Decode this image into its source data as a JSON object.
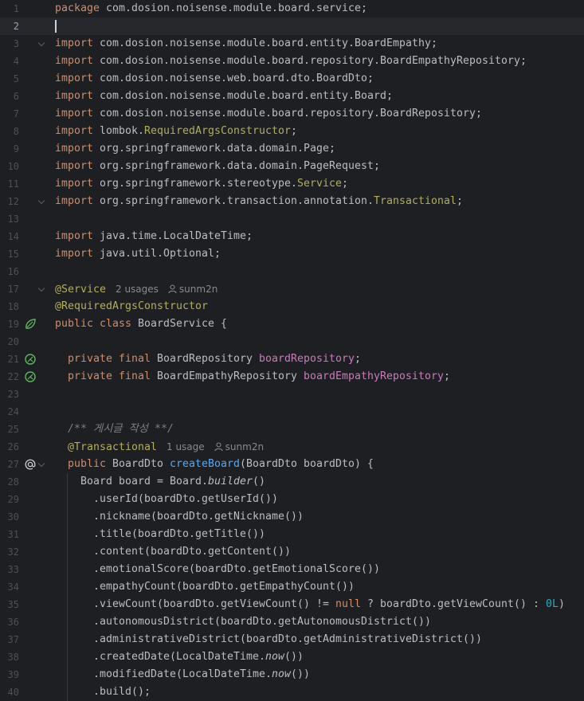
{
  "editor": {
    "language": "Java",
    "current_line": 2,
    "lines": [
      {
        "n": "1",
        "tokens": [
          {
            "t": "package",
            "c": "kw"
          },
          {
            "t": " com.dosion.noisense.module.board.service;"
          }
        ]
      },
      {
        "n": "2",
        "tokens": []
      },
      {
        "n": "3",
        "fold": true,
        "tokens": [
          {
            "t": "import",
            "c": "kw"
          },
          {
            "t": " com.dosion.noisense.module.board.entity.BoardEmpathy;"
          }
        ]
      },
      {
        "n": "4",
        "tokens": [
          {
            "t": "import",
            "c": "kw"
          },
          {
            "t": " com.dosion.noisense.module.board.repository.BoardEmpathyRepository;"
          }
        ]
      },
      {
        "n": "5",
        "tokens": [
          {
            "t": "import",
            "c": "kw"
          },
          {
            "t": " com.dosion.noisense.web.board.dto.BoardDto;"
          }
        ]
      },
      {
        "n": "6",
        "tokens": [
          {
            "t": "import",
            "c": "kw"
          },
          {
            "t": " com.dosion.noisense.module.board.entity.Board;"
          }
        ]
      },
      {
        "n": "7",
        "tokens": [
          {
            "t": "import",
            "c": "kw"
          },
          {
            "t": " com.dosion.noisense.module.board.repository.BoardRepository;"
          }
        ]
      },
      {
        "n": "8",
        "tokens": [
          {
            "t": "import",
            "c": "kw"
          },
          {
            "t": " lombok."
          },
          {
            "t": "RequiredArgsConstructor",
            "c": "ann"
          },
          {
            "t": ";"
          }
        ]
      },
      {
        "n": "9",
        "tokens": [
          {
            "t": "import",
            "c": "kw"
          },
          {
            "t": " org.springframework.data.domain.Page;"
          }
        ]
      },
      {
        "n": "10",
        "tokens": [
          {
            "t": "import",
            "c": "kw"
          },
          {
            "t": " org.springframework.data.domain.PageRequest;"
          }
        ]
      },
      {
        "n": "11",
        "tokens": [
          {
            "t": "import",
            "c": "kw"
          },
          {
            "t": " org.springframework.stereotype."
          },
          {
            "t": "Service",
            "c": "ann"
          },
          {
            "t": ";"
          }
        ]
      },
      {
        "n": "12",
        "fold": true,
        "tokens": [
          {
            "t": "import",
            "c": "kw"
          },
          {
            "t": " org.springframework.transaction.annotation."
          },
          {
            "t": "Transactional",
            "c": "ann"
          },
          {
            "t": ";"
          }
        ]
      },
      {
        "n": "13",
        "tokens": []
      },
      {
        "n": "14",
        "tokens": [
          {
            "t": "import",
            "c": "kw"
          },
          {
            "t": " java.time.LocalDateTime;"
          }
        ]
      },
      {
        "n": "15",
        "tokens": [
          {
            "t": "import",
            "c": "kw"
          },
          {
            "t": " java.util.Optional;"
          }
        ]
      },
      {
        "n": "16",
        "tokens": []
      },
      {
        "n": "17",
        "fold": true,
        "tokens": [
          {
            "t": "@Service",
            "c": "ann"
          }
        ],
        "hint": {
          "usages": "2 usages",
          "author": "sunm2n"
        }
      },
      {
        "n": "18",
        "tokens": [
          {
            "t": "@RequiredArgsConstructor",
            "c": "ann"
          }
        ]
      },
      {
        "n": "19",
        "gutter": "bean-class",
        "tokens": [
          {
            "t": "public class",
            "c": "kw"
          },
          {
            "t": " BoardService {"
          }
        ]
      },
      {
        "n": "20",
        "tokens": []
      },
      {
        "n": "21",
        "gutter": "bean-field",
        "tokens": [
          {
            "t": "  "
          },
          {
            "t": "private final",
            "c": "kw"
          },
          {
            "t": " BoardRepository "
          },
          {
            "t": "boardRepository",
            "c": "fld"
          },
          {
            "t": ";"
          }
        ]
      },
      {
        "n": "22",
        "gutter": "bean-field",
        "tokens": [
          {
            "t": "  "
          },
          {
            "t": "private final",
            "c": "kw"
          },
          {
            "t": " BoardEmpathyRepository "
          },
          {
            "t": "boardEmpathyRepository",
            "c": "fld"
          },
          {
            "t": ";"
          }
        ]
      },
      {
        "n": "23",
        "tokens": []
      },
      {
        "n": "24",
        "tokens": []
      },
      {
        "n": "25",
        "tokens": [
          {
            "t": "  "
          },
          {
            "t": "/** 게시글 작성 **/",
            "c": "cmt"
          }
        ]
      },
      {
        "n": "26",
        "tokens": [
          {
            "t": "  "
          },
          {
            "t": "@Transactional",
            "c": "ann"
          }
        ],
        "hint": {
          "usages": "1 usage",
          "author": "sunm2n"
        }
      },
      {
        "n": "27",
        "fold": true,
        "gutter": "at",
        "tokens": [
          {
            "t": "  "
          },
          {
            "t": "public",
            "c": "kw"
          },
          {
            "t": " BoardDto "
          },
          {
            "t": "createBoard",
            "c": "fn"
          },
          {
            "t": "(BoardDto boardDto) {"
          }
        ]
      },
      {
        "n": "28",
        "tokens": [
          {
            "t": "    Board board = Board."
          },
          {
            "t": "builder",
            "c": "it"
          },
          {
            "t": "()"
          }
        ]
      },
      {
        "n": "29",
        "tokens": [
          {
            "t": "      .userId(boardDto.getUserId())"
          }
        ]
      },
      {
        "n": "30",
        "tokens": [
          {
            "t": "      .nickname(boardDto.getNickname())"
          }
        ]
      },
      {
        "n": "31",
        "tokens": [
          {
            "t": "      .title(boardDto.getTitle())"
          }
        ]
      },
      {
        "n": "32",
        "tokens": [
          {
            "t": "      .content(boardDto.getContent())"
          }
        ]
      },
      {
        "n": "33",
        "tokens": [
          {
            "t": "      .emotionalScore(boardDto.getEmotionalScore())"
          }
        ]
      },
      {
        "n": "34",
        "tokens": [
          {
            "t": "      .empathyCount(boardDto.getEmpathyCount())"
          }
        ]
      },
      {
        "n": "35",
        "tokens": [
          {
            "t": "      .viewCount(boardDto.getViewCount() != "
          },
          {
            "t": "null",
            "c": "kw"
          },
          {
            "t": " ? boardDto.getViewCount() : "
          },
          {
            "t": "0L",
            "c": "num"
          },
          {
            "t": ")"
          }
        ]
      },
      {
        "n": "36",
        "tokens": [
          {
            "t": "      .autonomousDistrict(boardDto.getAutonomousDistrict())"
          }
        ]
      },
      {
        "n": "37",
        "tokens": [
          {
            "t": "      .administrativeDistrict(boardDto.getAdministrativeDistrict())"
          }
        ]
      },
      {
        "n": "38",
        "tokens": [
          {
            "t": "      .createdDate(LocalDateTime."
          },
          {
            "t": "now",
            "c": "it"
          },
          {
            "t": "())"
          }
        ]
      },
      {
        "n": "39",
        "tokens": [
          {
            "t": "      .modifiedDate(LocalDateTime."
          },
          {
            "t": "now",
            "c": "it"
          },
          {
            "t": "())"
          }
        ]
      },
      {
        "n": "40",
        "tokens": [
          {
            "t": "      .build();"
          }
        ]
      }
    ]
  },
  "colors": {
    "background": "#1e1f22",
    "current_line": "#26282e",
    "keyword": "#cf8e6d",
    "annotation": "#b3ae60",
    "field": "#c77dbb",
    "method": "#56a8f5",
    "number": "#2aacb8",
    "comment": "#7a7e85",
    "text": "#bcbec4",
    "bean_icon": "#5fb85f"
  },
  "icons": {
    "bean-class": "spring-bean-icon",
    "bean-field": "spring-bean-icon",
    "at": "at-sign-icon",
    "author": "user-icon"
  }
}
